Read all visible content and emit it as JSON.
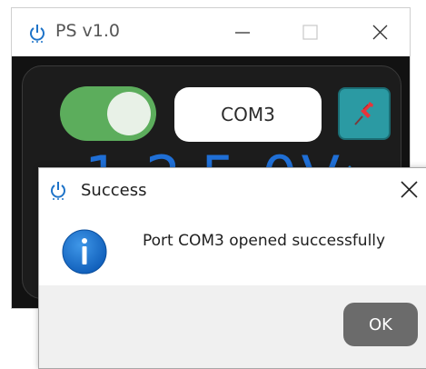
{
  "app": {
    "title": "PS v1.0",
    "icon": "power-icon",
    "window_controls": [
      "minimize-icon",
      "maximize-icon",
      "close-icon"
    ]
  },
  "controls": {
    "power_toggle": {
      "state": "on",
      "color": "#5cad5c"
    },
    "port_label": "COM3",
    "pin_icon": "pushpin-icon",
    "pin_button_color": "#2b9aa3"
  },
  "readout": {
    "value_a": "1.2",
    "value_b": "5.0V",
    "color": "#1f6fd6",
    "arrow_icon": "arrow-up-icon"
  },
  "dialog": {
    "title": "Success",
    "icon": "power-icon",
    "message": "Port COM3 opened successfully",
    "info_icon": "info-icon",
    "ok_label": "OK",
    "close_icon": "close-icon"
  }
}
